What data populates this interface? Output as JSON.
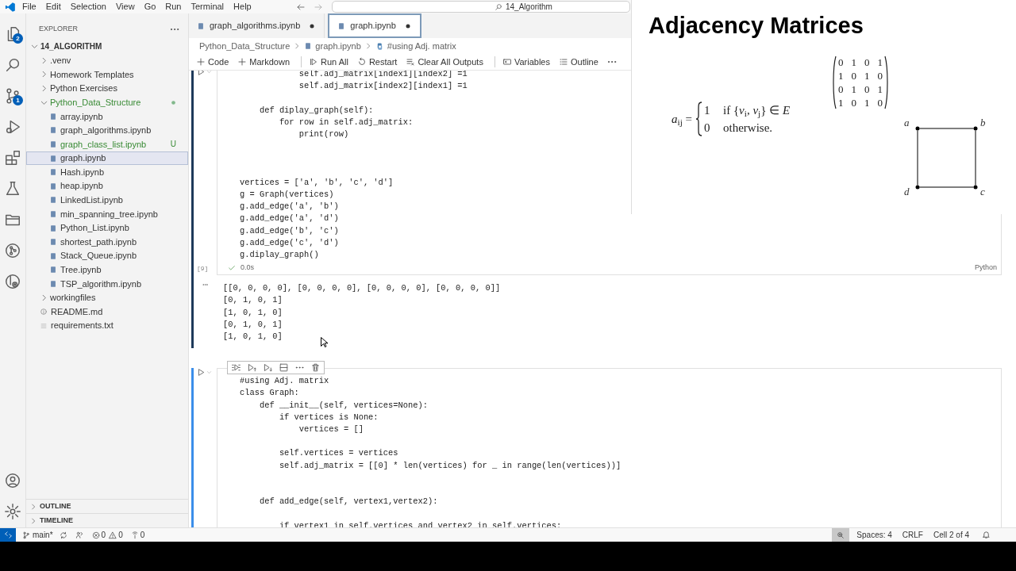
{
  "title_bar": {
    "menu": [
      "File",
      "Edit",
      "Selection",
      "View",
      "Go",
      "Run",
      "Terminal",
      "Help"
    ],
    "search": "14_Algorithm"
  },
  "activity_bar": {
    "items": [
      {
        "kind": "explorer",
        "badge": "2"
      },
      {
        "kind": "search"
      },
      {
        "kind": "scm",
        "badge": "1"
      },
      {
        "kind": "debug"
      },
      {
        "kind": "extensions"
      },
      {
        "kind": "testing"
      },
      {
        "kind": "folder"
      },
      {
        "kind": "graph"
      },
      {
        "kind": "remote"
      }
    ],
    "bottom": [
      {
        "kind": "account"
      },
      {
        "kind": "settings"
      }
    ]
  },
  "sidebar": {
    "title": "EXPLORER",
    "root": {
      "label": "14_ALGORITHM",
      "kind": "folder",
      "expanded": true,
      "selected": false,
      "children": [
        {
          "label": ".venv",
          "kind": "folder",
          "expanded": false,
          "selected": false
        },
        {
          "label": "Homework Templates",
          "kind": "folder",
          "expanded": false,
          "selected": false
        },
        {
          "label": "Python Exercises",
          "kind": "folder",
          "expanded": false,
          "selected": false
        },
        {
          "label": "Python_Data_Structure",
          "kind": "folder",
          "expanded": true,
          "selected": false,
          "has_changes": true,
          "children": [
            {
              "label": "array.ipynb",
              "kind": "notebook",
              "selected": false
            },
            {
              "label": "graph_algorithms.ipynb",
              "kind": "notebook",
              "selected": false
            },
            {
              "label": "graph_class_list.ipynb",
              "kind": "notebook",
              "selected": false,
              "git_badge": "U"
            },
            {
              "label": "graph.ipynb",
              "kind": "notebook",
              "selected": true
            },
            {
              "label": "Hash.ipynb",
              "kind": "notebook",
              "selected": false
            },
            {
              "label": "heap.ipynb",
              "kind": "notebook",
              "selected": false
            },
            {
              "label": "LinkedList.ipynb",
              "kind": "notebook",
              "selected": false
            },
            {
              "label": "min_spanning_tree.ipynb",
              "kind": "notebook",
              "selected": false
            },
            {
              "label": "Python_List.ipynb",
              "kind": "notebook",
              "selected": false
            },
            {
              "label": "shortest_path.ipynb",
              "kind": "notebook",
              "selected": false
            },
            {
              "label": "Stack_Queue.ipynb",
              "kind": "notebook",
              "selected": false
            },
            {
              "label": "Tree.ipynb",
              "kind": "notebook",
              "selected": false
            },
            {
              "label": "TSP_algorithm.ipynb",
              "kind": "notebook",
              "selected": false
            }
          ]
        },
        {
          "label": "workingfiles",
          "kind": "folder",
          "expanded": false,
          "selected": false
        },
        {
          "label": "README.md",
          "kind": "info",
          "selected": false
        },
        {
          "label": "requirements.txt",
          "kind": "text",
          "selected": false
        }
      ]
    },
    "panels": [
      {
        "label": "OUTLINE",
        "expanded": false
      },
      {
        "label": "TIMELINE",
        "expanded": false
      }
    ]
  },
  "tabs": [
    {
      "label": "graph_algorithms.ipynb",
      "selected": false,
      "dirty": true
    },
    {
      "label": "graph.ipynb",
      "selected": true,
      "dirty": true
    }
  ],
  "breadcrumb": [
    {
      "kind": "folder",
      "label": "Python_Data_Structure"
    },
    {
      "kind": "notebook",
      "label": "graph.ipynb"
    },
    {
      "kind": "cell",
      "label": "#using Adj. matrix"
    }
  ],
  "notebook_toolbar": [
    [
      {
        "kind": "add",
        "label": "Code"
      },
      {
        "kind": "add",
        "label": "Markdown"
      }
    ],
    [
      {
        "kind": "run-all",
        "label": "Run All"
      },
      {
        "kind": "restart",
        "label": "Restart"
      },
      {
        "kind": "clear",
        "label": "Clear All Outputs"
      }
    ],
    [
      {
        "kind": "variables",
        "label": "Variables"
      },
      {
        "kind": "outline",
        "label": "Outline"
      }
    ]
  ],
  "cells": [
    {
      "kind": "code",
      "selected": false,
      "code": "            self.adj_matrix[index1][index2] =1\n            self.adj_matrix[index2][index1] =1\n\n    def diplay_graph(self):\n        for row in self.adj_matrix:\n            print(row)\n\n\n\nvertices = ['a', 'b', 'c', 'd']\ng = Graph(vertices)\ng.add_edge('a', 'b')\ng.add_edge('a', 'd')\ng.add_edge('b', 'c')\ng.add_edge('c', 'd')\ng.diplay_graph()",
      "execution_count": "[9]",
      "succeeded": true,
      "duration": "0.0s",
      "language": "Python",
      "output": "[[0, 0, 0, 0], [0, 0, 0, 0], [0, 0, 0, 0], [0, 0, 0, 0]]\n[0, 1, 0, 1]\n[1, 0, 1, 0]\n[0, 1, 0, 1]\n[1, 0, 1, 0]"
    },
    {
      "kind": "code",
      "selected": true,
      "code": "#using Adj. matrix\nclass Graph:\n    def __init__(self, vertices=None):\n        if vertices is None:\n            vertices = []\n\n        self.vertices = vertices\n        self.adj_matrix = [[0] * len(vertices) for _ in range(len(vertices))]\n\n\n    def add_edge(self, vertex1,vertex2):\n\n        if vertex1 in self.vertices and vertex2 in self.vertices:"
    }
  ],
  "status_bar": {
    "left": [
      {
        "kind": "remote"
      },
      {
        "kind": "branch",
        "label": "main*"
      },
      {
        "kind": "sync"
      },
      {
        "kind": "live"
      },
      {
        "kind": "problems",
        "errors": "0",
        "warnings": "0"
      },
      {
        "kind": "ports",
        "label": "0"
      }
    ],
    "right": [
      {
        "kind": "zoom"
      },
      {
        "kind": "text",
        "label": "Spaces: 4"
      },
      {
        "kind": "text",
        "label": "CRLF"
      },
      {
        "kind": "text",
        "label": "Cell 2 of 4"
      },
      {
        "kind": "bell"
      }
    ]
  },
  "slide": {
    "title": "Adjacency Matrices",
    "formula": {
      "lhs": "*a*$_{ij}$ =",
      "cases": [
        {
          "value": "1",
          "condition": "if {*v*$_{i}$, *v*$_{j}$} ∈ *E*"
        },
        {
          "value": "0",
          "condition": "otherwise."
        }
      ]
    },
    "matrix": [
      [
        "0",
        "1",
        "0",
        "1"
      ],
      [
        "1",
        "0",
        "1",
        "0"
      ],
      [
        "0",
        "1",
        "0",
        "1"
      ],
      [
        "1",
        "0",
        "1",
        "0"
      ]
    ],
    "graph": {
      "nodes": [
        "a",
        "b",
        "d",
        "c"
      ]
    }
  }
}
